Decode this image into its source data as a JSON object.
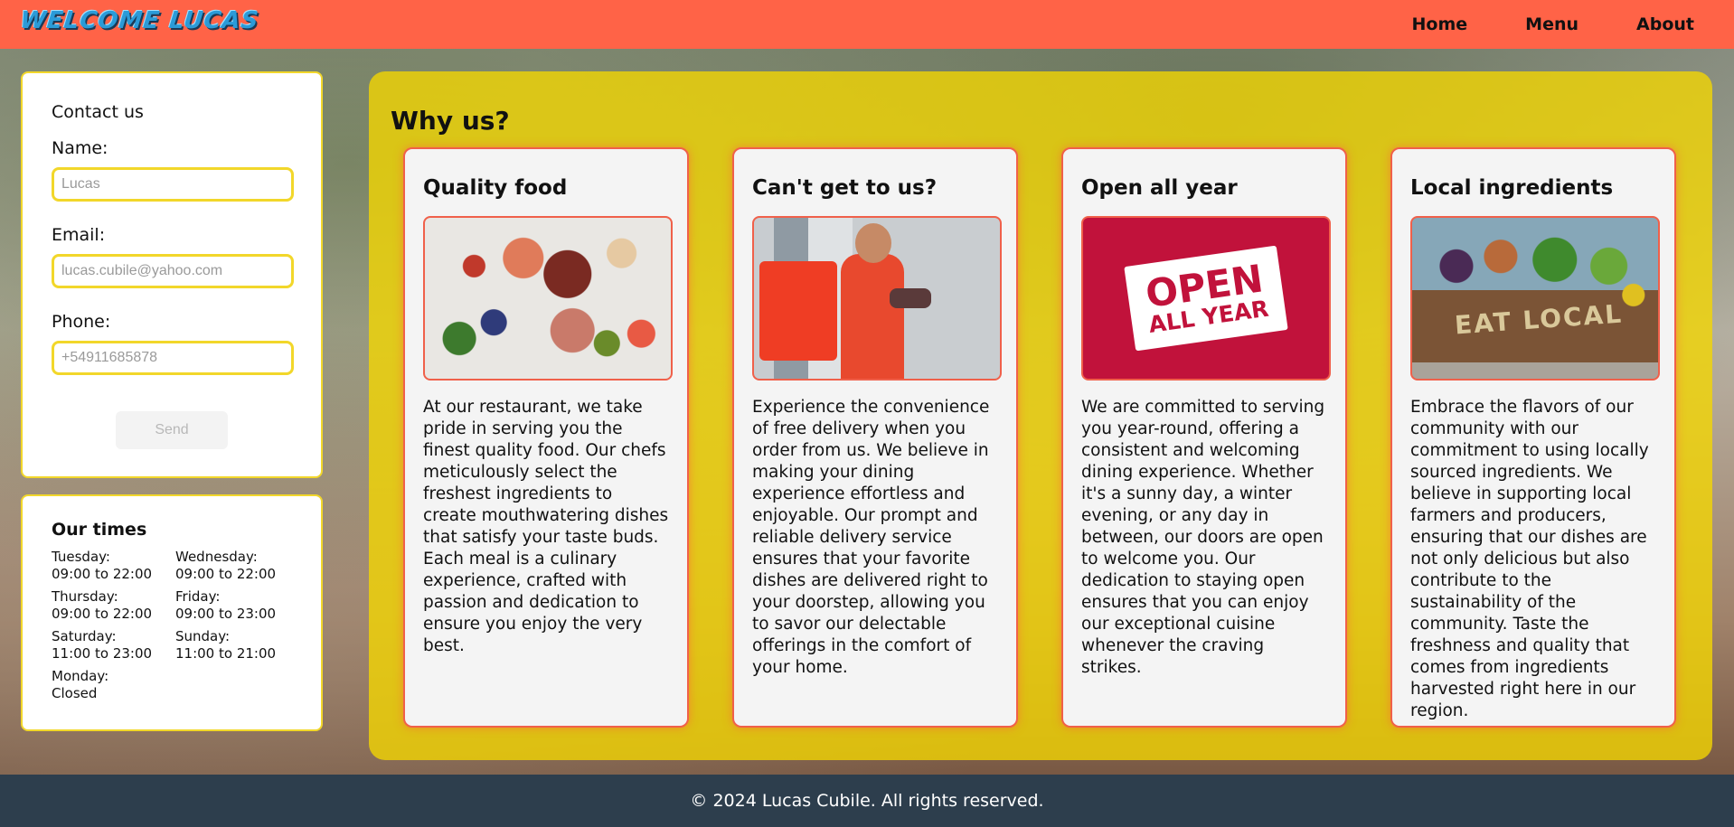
{
  "header": {
    "logo_text": "WELCOME LUCAS",
    "nav": [
      {
        "label": "Home"
      },
      {
        "label": "Menu"
      },
      {
        "label": "About"
      }
    ]
  },
  "contact": {
    "title": "Contact us",
    "name_label": "Name:",
    "name_placeholder": "Lucas",
    "email_label": "Email:",
    "email_placeholder": "lucas.cubile@yahoo.com",
    "phone_label": "Phone:",
    "phone_placeholder": "+54911685878",
    "send_label": "Send"
  },
  "times": {
    "title": "Our times",
    "days": [
      {
        "day": "Tuesday:",
        "hours": "09:00 to 22:00"
      },
      {
        "day": "Wednesday:",
        "hours": "09:00 to 22:00"
      },
      {
        "day": "Thursday:",
        "hours": "09:00 to 22:00"
      },
      {
        "day": "Friday:",
        "hours": "09:00 to 23:00"
      },
      {
        "day": "Saturday:",
        "hours": "11:00 to 23:00"
      },
      {
        "day": "Sunday:",
        "hours": "11:00 to 21:00"
      },
      {
        "day": "Monday:",
        "hours": "Closed"
      }
    ]
  },
  "why": {
    "title": "Why us?",
    "cards": [
      {
        "title": "Quality food",
        "image": "fresh-ingredients-photo",
        "text": "At our restaurant, we take pride in serving you the finest quality food. Our chefs meticulously select the freshest ingredients to create mouthwatering dishes that satisfy your taste buds. Each meal is a culinary experience, crafted with passion and dedication to ensure you enjoy the very best."
      },
      {
        "title": "Can't get to us?",
        "image": "delivery-courier-photo",
        "text": "Experience the convenience of free delivery when you order from us. We believe in making your dining experience effortless and enjoyable. Our prompt and reliable delivery service ensures that your favorite dishes are delivered right to your doorstep, allowing you to savor our delectable offerings in the comfort of your home."
      },
      {
        "title": "Open all year",
        "image": "open-all-year-sign",
        "sign_line1": "OPEN",
        "sign_line2": "ALL YEAR",
        "text": "We are committed to serving you year-round, offering a consistent and welcoming dining experience. Whether it's a sunny day, a winter evening, or any day in between, our doors are open to welcome you. Our dedication to staying open ensures that you can enjoy our exceptional cuisine whenever the craving strikes."
      },
      {
        "title": "Local ingredients",
        "image": "eat-local-crate-photo",
        "crate_text": "EAT LOCAL",
        "text": "Embrace the flavors of our community with our commitment to using locally sourced ingredients. We believe in supporting local farmers and producers, ensuring that our dishes are not only delicious but also contribute to the sustainability of the community. Taste the freshness and quality that comes from ingredients harvested right here in our region."
      }
    ]
  },
  "footer": {
    "text": "© 2024 Lucas Cubile. All rights reserved."
  },
  "colors": {
    "header": "#ff6347",
    "panel": "#f5d700",
    "card_border": "#f0604a",
    "footer": "#2d3e4d"
  }
}
